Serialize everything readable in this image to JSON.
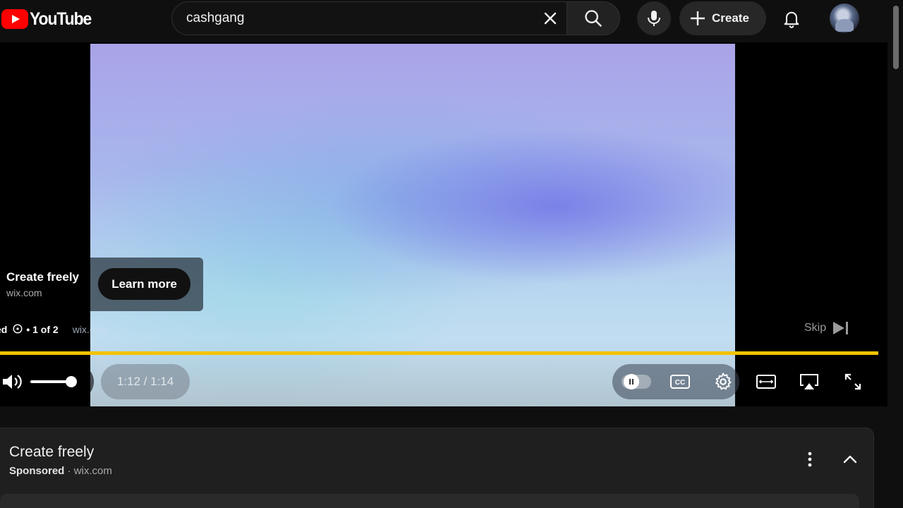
{
  "brand": {
    "name": "YouTube",
    "accent": "#ff0000"
  },
  "search": {
    "query": "cashgang",
    "placeholder": "Search"
  },
  "header": {
    "create_label": "Create"
  },
  "ad_overlay": {
    "title": "Create freely",
    "domain": "wix.com",
    "cta_label": "Learn more",
    "sponsored_fragment": "ed",
    "position_text": "• 1 of 2",
    "overlay_domain": "wix.com"
  },
  "player": {
    "skip_label": "Skip",
    "time_text": "1:12 / 1:14",
    "progress_fraction": 0.97,
    "progress_color": "#f2c300",
    "volume_fraction": 1.0
  },
  "ad_card": {
    "title": "Create freely",
    "sponsored_label": "Sponsored",
    "separator": " · ",
    "domain": "wix.com"
  },
  "icons": [
    "youtube-logo-icon",
    "close-icon",
    "search-icon",
    "microphone-icon",
    "plus-icon",
    "bell-icon",
    "info-icon",
    "skip-next-icon",
    "volume-icon",
    "pause-icon",
    "captions-icon",
    "settings-gear-icon",
    "theater-mode-icon",
    "airplay-icon",
    "fullscreen-icon",
    "more-vertical-icon",
    "chevron-up-icon"
  ]
}
